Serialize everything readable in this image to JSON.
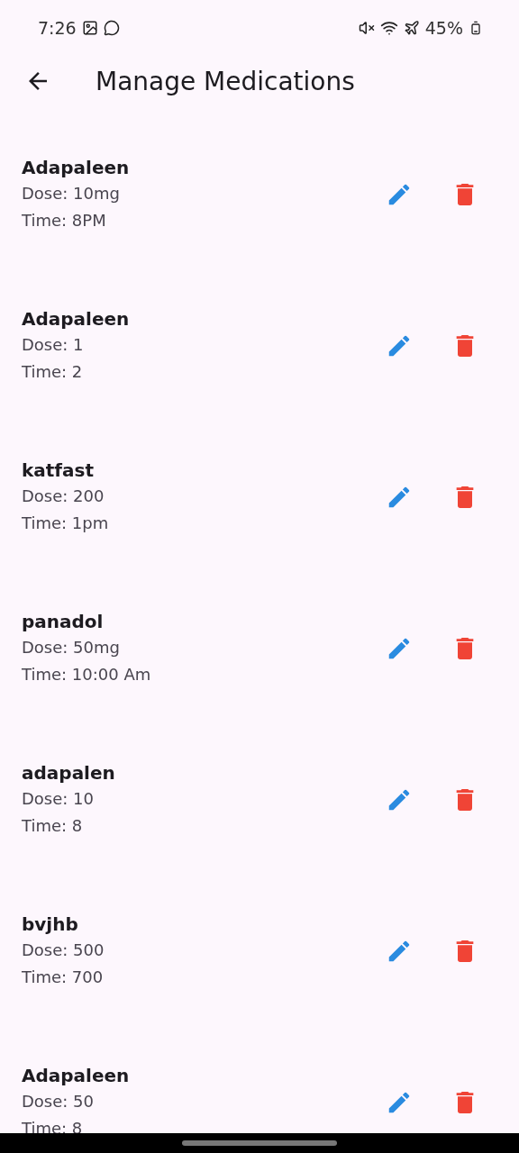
{
  "status_bar": {
    "time": "7:26",
    "battery": "45%"
  },
  "app_bar": {
    "title": "Manage Medications"
  },
  "medications": [
    {
      "name": "Adapaleen",
      "dose": "Dose: 10mg",
      "time": "Time: 8PM"
    },
    {
      "name": "Adapaleen",
      "dose": "Dose: 1",
      "time": "Time: 2"
    },
    {
      "name": "katfast",
      "dose": "Dose: 200",
      "time": "Time: 1pm"
    },
    {
      "name": "panadol",
      "dose": "Dose: 50mg",
      "time": "Time: 10:00 Am"
    },
    {
      "name": "adapalen",
      "dose": "Dose: 10",
      "time": "Time: 8"
    },
    {
      "name": "bvjhb",
      "dose": "Dose: 500",
      "time": "Time: 700"
    },
    {
      "name": "Adapaleen",
      "dose": "Dose: 50",
      "time": "Time: 8"
    }
  ]
}
